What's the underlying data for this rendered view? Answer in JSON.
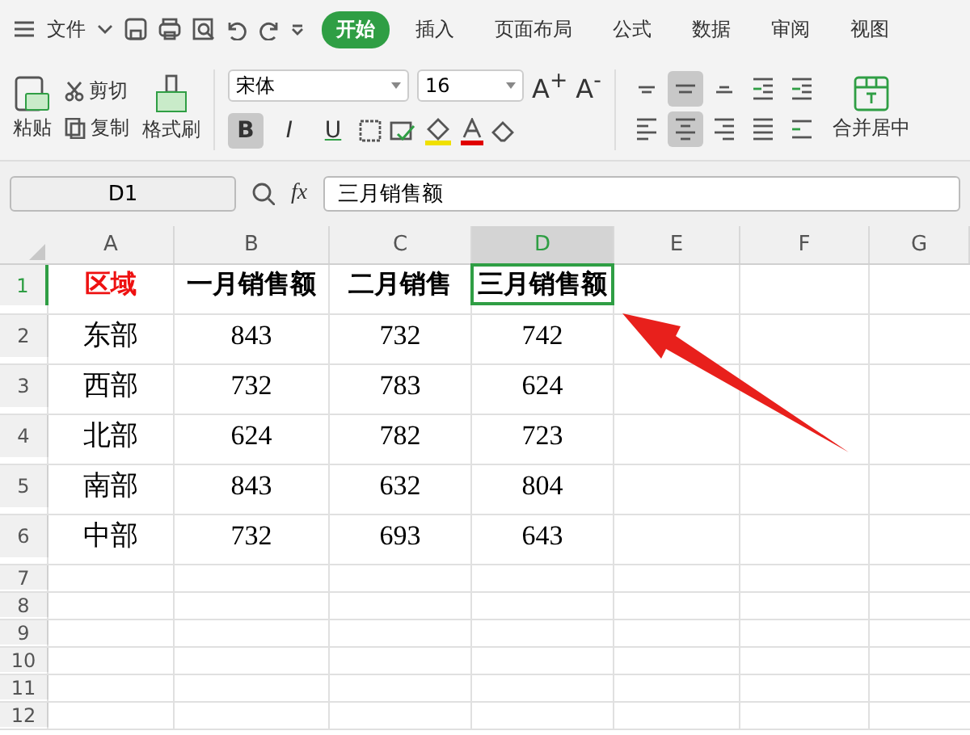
{
  "menu": {
    "file": "文件",
    "tabs": [
      {
        "label": "开始",
        "selected": true
      },
      {
        "label": "插入",
        "selected": false
      },
      {
        "label": "页面布局",
        "selected": false
      },
      {
        "label": "公式",
        "selected": false
      },
      {
        "label": "数据",
        "selected": false
      },
      {
        "label": "审阅",
        "selected": false
      },
      {
        "label": "视图",
        "selected": false
      }
    ]
  },
  "ribbon": {
    "paste": "粘贴",
    "cut": "剪切",
    "copy": "复制",
    "format_painter": "格式刷",
    "font": "宋体",
    "size": "16",
    "grow_font": "A$^{+}$",
    "shrink_font": "A$^{-}$",
    "styles": [
      {
        "kind": "bold",
        "label": "B",
        "selected": true
      },
      {
        "kind": "italic",
        "label": "I",
        "selected": false
      },
      {
        "kind": "underline",
        "label": "U",
        "selected": false
      }
    ],
    "align": [
      {
        "kind": "top",
        "selected": false
      },
      {
        "kind": "middle",
        "selected": true
      },
      {
        "kind": "bottom",
        "selected": false
      },
      {
        "kind": "outdent",
        "selected": false
      },
      {
        "kind": "indent",
        "selected": false
      },
      {
        "kind": "left",
        "selected": false
      },
      {
        "kind": "center",
        "selected": true
      },
      {
        "kind": "right",
        "selected": false
      },
      {
        "kind": "justify",
        "selected": false
      },
      {
        "kind": "distribute",
        "selected": false
      }
    ],
    "merge": "合并居中"
  },
  "formula_bar": {
    "cell_ref": "D1",
    "fx": "fx",
    "value": "三月销售额"
  },
  "columns": [
    {
      "label": "A",
      "selected": false
    },
    {
      "label": "B",
      "selected": false
    },
    {
      "label": "C",
      "selected": false
    },
    {
      "label": "D",
      "selected": true
    },
    {
      "label": "E",
      "selected": false
    },
    {
      "label": "F",
      "selected": false
    },
    {
      "label": "G",
      "selected": false
    }
  ],
  "rows": [
    {
      "number": "1",
      "selected": true,
      "kind": "heading",
      "cells": [
        {
          "text": "区域",
          "highlight": true
        },
        {
          "text": "一月销售额",
          "highlight": false
        },
        {
          "text": "二月销售",
          "highlight": false
        },
        {
          "text": "三月销售额",
          "highlight": false
        }
      ]
    },
    {
      "number": "2",
      "selected": false,
      "kind": "data",
      "cells": [
        {
          "text": "东部",
          "highlight": false
        },
        {
          "text": "843",
          "highlight": false
        },
        {
          "text": "732",
          "highlight": false
        },
        {
          "text": "742",
          "highlight": false
        }
      ]
    },
    {
      "number": "3",
      "selected": false,
      "kind": "data",
      "cells": [
        {
          "text": "西部",
          "highlight": false
        },
        {
          "text": "732",
          "highlight": false
        },
        {
          "text": "783",
          "highlight": false
        },
        {
          "text": "624",
          "highlight": false
        }
      ]
    },
    {
      "number": "4",
      "selected": false,
      "kind": "data",
      "cells": [
        {
          "text": "北部",
          "highlight": false
        },
        {
          "text": "624",
          "highlight": false
        },
        {
          "text": "782",
          "highlight": false
        },
        {
          "text": "723",
          "highlight": false
        }
      ]
    },
    {
      "number": "5",
      "selected": false,
      "kind": "data",
      "cells": [
        {
          "text": "南部",
          "highlight": false
        },
        {
          "text": "843",
          "highlight": false
        },
        {
          "text": "632",
          "highlight": false
        },
        {
          "text": "804",
          "highlight": false
        }
      ]
    },
    {
      "number": "6",
      "selected": false,
      "kind": "data",
      "cells": [
        {
          "text": "中部",
          "highlight": false
        },
        {
          "text": "732",
          "highlight": false
        },
        {
          "text": "693",
          "highlight": false
        },
        {
          "text": "643",
          "highlight": false
        }
      ]
    },
    {
      "number": "7",
      "selected": false,
      "kind": "empty"
    },
    {
      "number": "8",
      "selected": false,
      "kind": "empty"
    },
    {
      "number": "9",
      "selected": false,
      "kind": "empty"
    },
    {
      "number": "10",
      "selected": false,
      "kind": "empty"
    },
    {
      "number": "11",
      "selected": false,
      "kind": "empty"
    },
    {
      "number": "12",
      "selected": false,
      "kind": "empty"
    }
  ]
}
